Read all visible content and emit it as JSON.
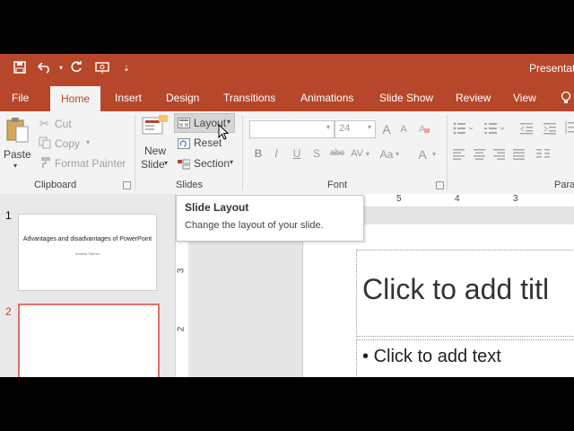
{
  "window": {
    "title": "Presentati"
  },
  "tabs": [
    "File",
    "Home",
    "Insert",
    "Design",
    "Transitions",
    "Animations",
    "Slide Show",
    "Review",
    "View"
  ],
  "clipboard": {
    "paste": "Paste",
    "cut": "Cut",
    "copy": "Copy",
    "format_painter": "Format Painter",
    "group_label": "Clipboard"
  },
  "slides": {
    "new_slide_line1": "New",
    "new_slide_line2": "Slide",
    "layout": "Layout",
    "reset": "Reset",
    "section": "Section",
    "group_label": "Slides"
  },
  "font": {
    "font_name": "",
    "font_size": "24",
    "group_label": "Font",
    "bold": "B",
    "italic": "I",
    "underline": "U",
    "shadow": "S",
    "strikethrough": "abc",
    "spacing": "AV",
    "change_case": "Aa",
    "grow": "A",
    "shrink": "A",
    "color": "A"
  },
  "paragraph": {
    "group_label": "Para"
  },
  "tooltip": {
    "title": "Slide Layout",
    "description": "Change the layout of your slide."
  },
  "ruler": {
    "h_numbers": [
      "5",
      "4",
      "3"
    ],
    "v_numbers": [
      "3",
      "2"
    ]
  },
  "thumbnails": [
    {
      "number": "1",
      "title": "Advantages and disadvantages of PowerPoint",
      "subtitle": "Anneke Palmer"
    },
    {
      "number": "2"
    }
  ],
  "slide": {
    "title_placeholder": "Click to add titl",
    "body_placeholder": "Click to add text",
    "bullet": "•"
  },
  "colors": {
    "accent": "#b7472a",
    "selected_thumb": "#e3706b"
  }
}
